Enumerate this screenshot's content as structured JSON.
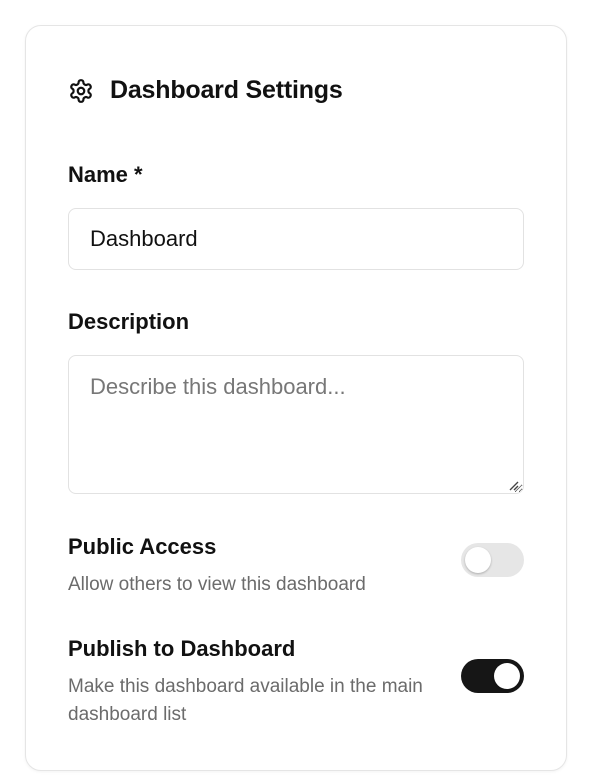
{
  "header": {
    "title": "Dashboard Settings",
    "icon": "gear-icon"
  },
  "name_field": {
    "label": "Name *",
    "value": "Dashboard"
  },
  "description_field": {
    "label": "Description",
    "value": "",
    "placeholder": "Describe this dashboard..."
  },
  "toggles": [
    {
      "title": "Public Access",
      "description": "Allow others to view this dashboard",
      "enabled": false
    },
    {
      "title": "Publish to Dashboard",
      "description": "Make this dashboard available in the main dashboard list",
      "enabled": true
    }
  ],
  "colors": {
    "toggle_on": "#161616",
    "toggle_off": "#e6e6e6",
    "muted_text": "#6b6b6b"
  }
}
